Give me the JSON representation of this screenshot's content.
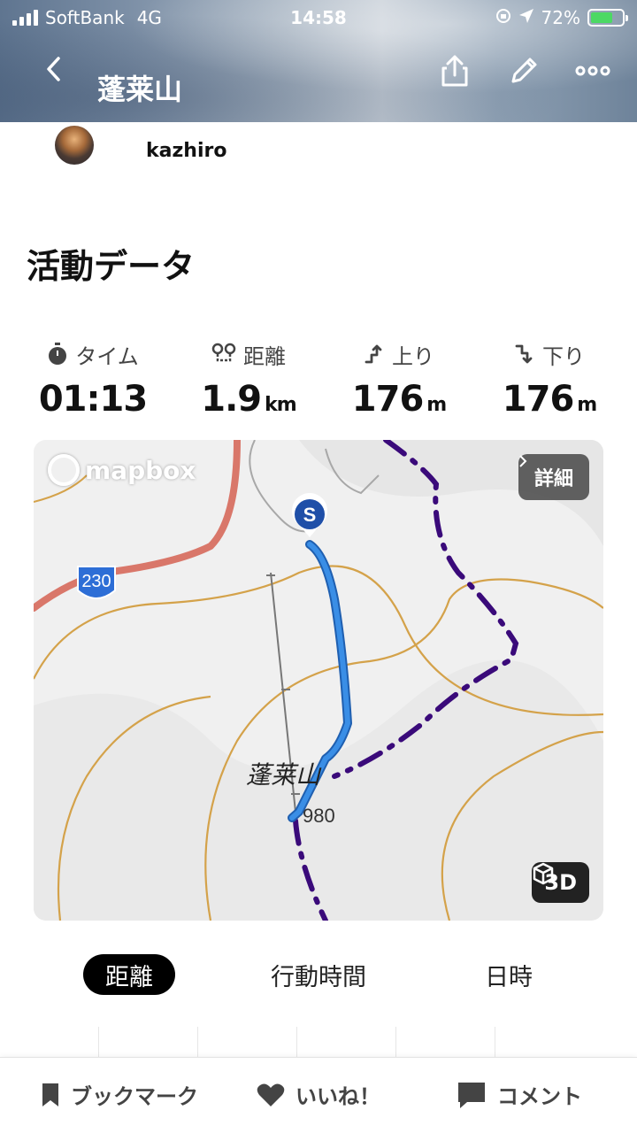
{
  "status_bar": {
    "carrier": "SoftBank",
    "network": "4G",
    "time": "14:58",
    "battery": "72%"
  },
  "header": {
    "title": "蓬莱山",
    "icons": [
      "back-icon",
      "share-icon",
      "edit-icon",
      "more-icon"
    ]
  },
  "user": {
    "name": "kazhiro"
  },
  "section": {
    "title": "活動データ"
  },
  "stats": {
    "time": {
      "label": "タイム",
      "value": "01:13",
      "unit": ""
    },
    "distance": {
      "label": "距離",
      "value": "1.9",
      "unit": "km"
    },
    "ascent": {
      "label": "上り",
      "value": "176",
      "unit": "m"
    },
    "descent": {
      "label": "下り",
      "value": "176",
      "unit": "m"
    }
  },
  "map": {
    "logo": "mapbox",
    "detail_label": "詳細",
    "mode_label": "3D",
    "route_badge": "230",
    "start_marker": "S",
    "peak_label": "蓬莱山",
    "peak_elevation": "980",
    "colors": {
      "route": "#3a8ee6",
      "boundary": "#3a0a7a",
      "contour": "#d4a24a",
      "road": "#d9776a"
    }
  },
  "tabs": {
    "distance": "距離",
    "moving_time": "行動時間",
    "datetime": "日時",
    "active": "distance"
  },
  "bottom_bar": {
    "bookmark": "ブックマーク",
    "like": "いいね！",
    "comment": "コメント"
  }
}
